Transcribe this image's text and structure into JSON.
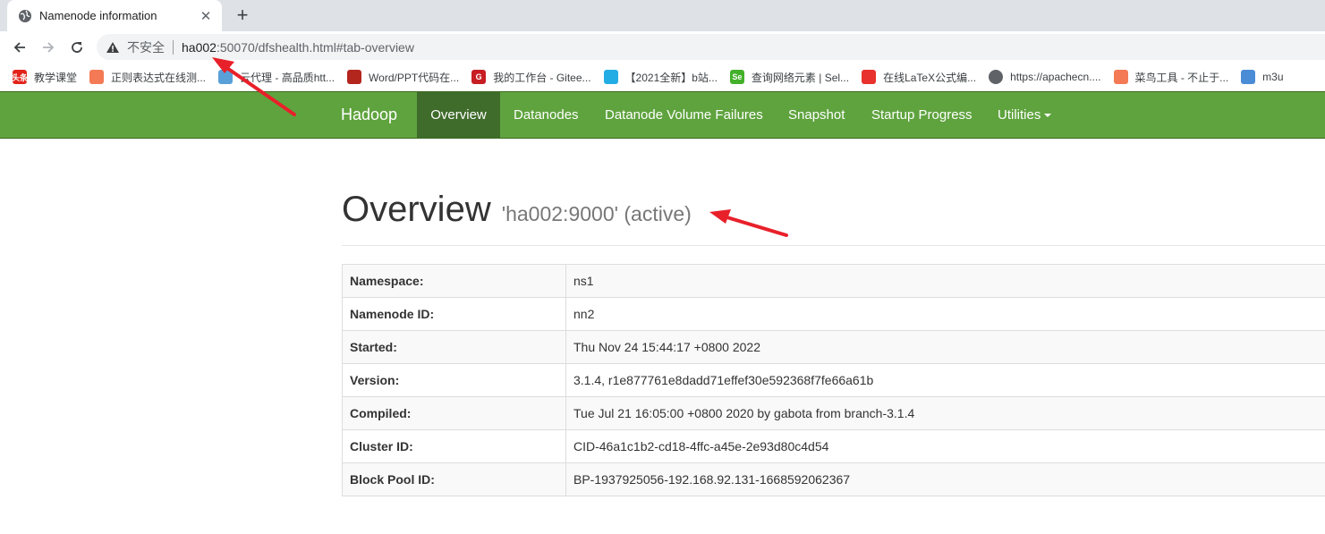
{
  "browser": {
    "tab_title": "Namenode information",
    "close_glyph": "✕",
    "newtab_glyph": "+",
    "security_label": "不安全",
    "url_host": "ha002",
    "url_rest": ":50070/dfshealth.html#tab-overview"
  },
  "bookmarks": [
    {
      "label": "教学课堂",
      "icon": "jiaoxue-icon",
      "color": "#e2231a",
      "glyph": "头条"
    },
    {
      "label": "正则表达式在线测...",
      "icon": "cube-icon",
      "color": "#f47a55",
      "glyph": ""
    },
    {
      "label": "云代理 - 高品质htt...",
      "icon": "image-icon",
      "color": "#5aa0d8",
      "glyph": ""
    },
    {
      "label": "Word/PPT代码在...",
      "icon": "word-icon",
      "color": "#b3261e",
      "glyph": ""
    },
    {
      "label": "我的工作台 - Gitee...",
      "icon": "gitee-icon",
      "color": "#c71d23",
      "glyph": "G"
    },
    {
      "label": "【2021全新】b站...",
      "icon": "bilibili-icon",
      "color": "#23ade5",
      "glyph": ""
    },
    {
      "label": "查询网络元素 | Sel...",
      "icon": "selenium-icon",
      "color": "#43b02a",
      "glyph": "Se"
    },
    {
      "label": "在线LaTeX公式编...",
      "icon": "latex-icon",
      "color": "#e8322d",
      "glyph": ""
    },
    {
      "label": "https://apachecn....",
      "icon": "globe-icon",
      "color": "#5f6368",
      "glyph": ""
    },
    {
      "label": "菜鸟工具 - 不止于...",
      "icon": "cube-icon",
      "color": "#f47a55",
      "glyph": ""
    },
    {
      "label": "m3u",
      "icon": "rocket-icon",
      "color": "#4a8cd6",
      "glyph": ""
    }
  ],
  "nav": {
    "brand": "Hadoop",
    "items": [
      "Overview",
      "Datanodes",
      "Datanode Volume Failures",
      "Snapshot",
      "Startup Progress",
      "Utilities"
    ]
  },
  "overview": {
    "title": "Overview",
    "subtitle": "'ha002:9000' (active)"
  },
  "info_table": [
    {
      "key": "Namespace:",
      "value": "ns1"
    },
    {
      "key": "Namenode ID:",
      "value": "nn2"
    },
    {
      "key": "Started:",
      "value": "Thu Nov 24 15:44:17 +0800 2022"
    },
    {
      "key": "Version:",
      "value": "3.1.4, r1e877761e8dadd71effef30e592368f7fe66a61b"
    },
    {
      "key": "Compiled:",
      "value": "Tue Jul 21 16:05:00 +0800 2020 by gabota from branch-3.1.4"
    },
    {
      "key": "Cluster ID:",
      "value": "CID-46a1c1b2-cd18-4ffc-a45e-2e93d80c4d54"
    },
    {
      "key": "Block Pool ID:",
      "value": "BP-1937925056-192.168.92.131-1668592062367"
    }
  ],
  "colors": {
    "navbar": "#5fa33e",
    "navbar_active": "#3f6b2b",
    "annotation": "#e8202a"
  }
}
